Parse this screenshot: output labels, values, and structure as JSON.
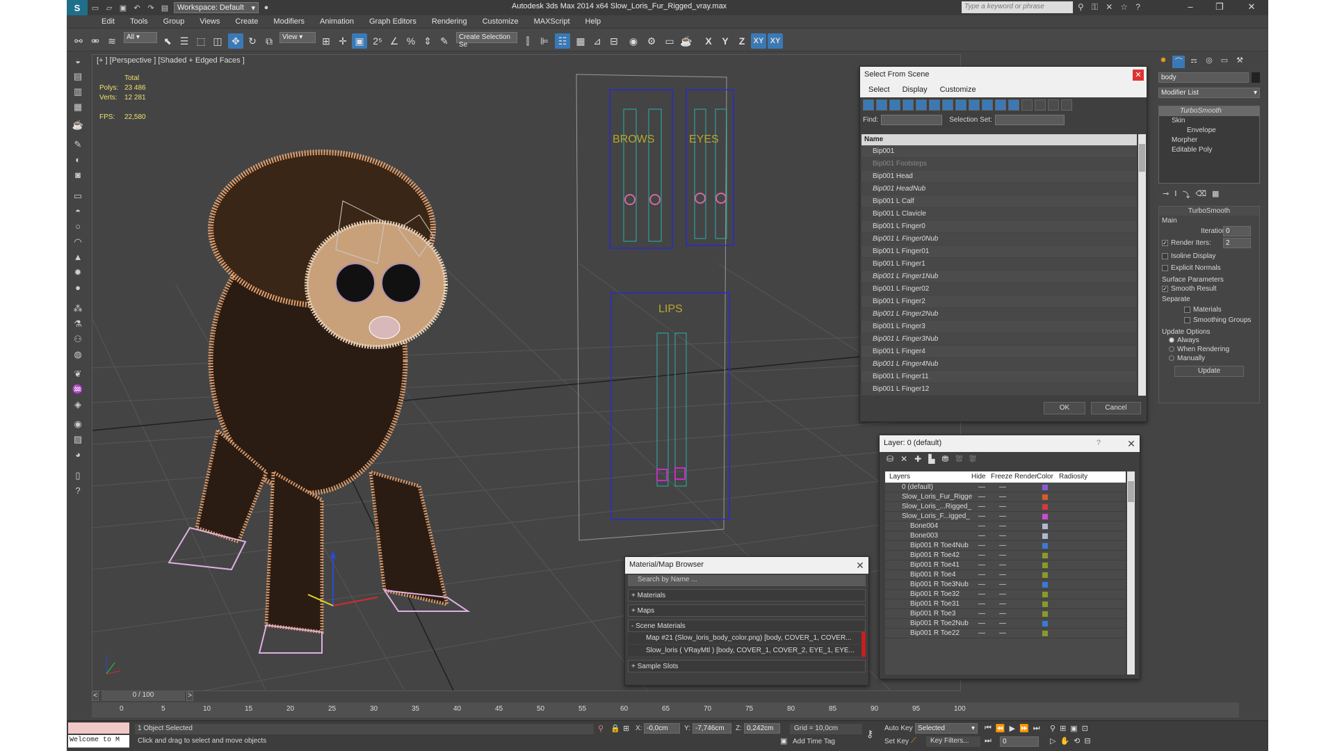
{
  "titlebar": {
    "app_title": "Autodesk 3ds Max  2014 x64     Slow_Loris_Fur_Rigged_vray.max",
    "workspace": "Workspace: Default",
    "search_placeholder": "Type a keyword or phrase"
  },
  "menu": [
    "Edit",
    "Tools",
    "Group",
    "Views",
    "Create",
    "Modifiers",
    "Animation",
    "Graph Editors",
    "Rendering",
    "Customize",
    "MAXScript",
    "Help"
  ],
  "toolbar": {
    "filter_select": "All",
    "coord_select": "View",
    "selection_set": "Create Selection Se",
    "axis_x": "X",
    "axis_y": "Y",
    "axis_z": "Z",
    "axis_xy": "XY",
    "axis_xy2": "XY"
  },
  "viewport": {
    "label": "[+ ] [Perspective ] [Shaded + Edged Faces ]",
    "stats_header": "Total",
    "polys_label": "Polys:",
    "polys": "23 486",
    "verts_label": "Verts:",
    "verts": "12 281",
    "fps_label": "FPS:",
    "fps": "22,580",
    "brows_label": "BROWS",
    "eyes_label": "EYES",
    "lips_label": "LIPS"
  },
  "select_from_scene": {
    "title": "Select From Scene",
    "menu": [
      "Select",
      "Display",
      "Customize"
    ],
    "find_label": "Find:",
    "selection_set_label": "Selection Set:",
    "column_name": "Name",
    "items": [
      {
        "name": "Bip001",
        "style": "normal"
      },
      {
        "name": "Bip001 Footsteps",
        "style": "dim"
      },
      {
        "name": "Bip001 Head",
        "style": "normal"
      },
      {
        "name": "Bip001 HeadNub",
        "style": "italic"
      },
      {
        "name": "Bip001 L Calf",
        "style": "normal"
      },
      {
        "name": "Bip001 L Clavicle",
        "style": "normal"
      },
      {
        "name": "Bip001 L Finger0",
        "style": "normal"
      },
      {
        "name": "Bip001 L Finger0Nub",
        "style": "italic"
      },
      {
        "name": "Bip001 L Finger01",
        "style": "normal"
      },
      {
        "name": "Bip001 L Finger1",
        "style": "normal"
      },
      {
        "name": "Bip001 L Finger1Nub",
        "style": "italic"
      },
      {
        "name": "Bip001 L Finger02",
        "style": "normal"
      },
      {
        "name": "Bip001 L Finger2",
        "style": "normal"
      },
      {
        "name": "Bip001 L Finger2Nub",
        "style": "italic"
      },
      {
        "name": "Bip001 L Finger3",
        "style": "normal"
      },
      {
        "name": "Bip001 L Finger3Nub",
        "style": "italic"
      },
      {
        "name": "Bip001 L Finger4",
        "style": "normal"
      },
      {
        "name": "Bip001 L Finger4Nub",
        "style": "italic"
      },
      {
        "name": "Bip001 L Finger11",
        "style": "normal"
      },
      {
        "name": "Bip001 L Finger12",
        "style": "normal"
      }
    ],
    "ok": "OK",
    "cancel": "Cancel"
  },
  "layer_dialog": {
    "title": "Layer: 0 (default)",
    "help": "?",
    "columns": [
      "Layers",
      "Hide",
      "Freeze",
      "Render",
      "Color",
      "Radiosity"
    ],
    "rows": [
      {
        "name": "0 (default)",
        "color": "#8a5ad8",
        "indent": 0
      },
      {
        "name": "Slow_Loris_Fur_Rigge",
        "color": "#d85a2a",
        "indent": 0
      },
      {
        "name": "Slow_Loris_...Rigged_",
        "color": "#d83a3a",
        "indent": 0
      },
      {
        "name": "Slow_Loris_F...igged_",
        "color": "#c84ad8",
        "indent": 0
      },
      {
        "name": "Bone004",
        "color": "#b0b8d0",
        "indent": 1
      },
      {
        "name": "Bone003",
        "color": "#b0b8d0",
        "indent": 1
      },
      {
        "name": "Bip001 R Toe4Nub",
        "color": "#3a7ad8",
        "indent": 1
      },
      {
        "name": "Bip001 R Toe42",
        "color": "#8a9a2a",
        "indent": 1
      },
      {
        "name": "Bip001 R Toe41",
        "color": "#8a9a2a",
        "indent": 1
      },
      {
        "name": "Bip001 R Toe4",
        "color": "#8a9a2a",
        "indent": 1
      },
      {
        "name": "Bip001 R Toe3Nub",
        "color": "#3a7ad8",
        "indent": 1
      },
      {
        "name": "Bip001 R Toe32",
        "color": "#8a9a2a",
        "indent": 1
      },
      {
        "name": "Bip001 R Toe31",
        "color": "#8a9a2a",
        "indent": 1
      },
      {
        "name": "Bip001 R Toe3",
        "color": "#8a9a2a",
        "indent": 1
      },
      {
        "name": "Bip001 R Toe2Nub",
        "color": "#3a7ad8",
        "indent": 1
      },
      {
        "name": "Bip001 R Toe22",
        "color": "#8a9a2a",
        "indent": 1
      }
    ]
  },
  "material_browser": {
    "title": "Material/Map Browser",
    "search_placeholder": "Search by Name ...",
    "sections": {
      "materials": "+ Materials",
      "maps": "+ Maps",
      "scene_materials": "- Scene Materials",
      "sample_slots": "+ Sample Slots"
    },
    "scene_items": [
      "Map #21 (Slow_loris_body_color.png) [body, COVER_1, COVER...",
      "Slow_loris  ( VRayMtl ) [body, COVER_1, COVER_2, EYE_1, EYE..."
    ]
  },
  "command_panel": {
    "object_name": "body",
    "modifier_list": "Modifier List",
    "stack": [
      "TurboSmooth",
      "Skin",
      "Envelope",
      "Morpher",
      "Editable Poly"
    ],
    "rollout_title": "TurboSmooth",
    "main_label": "Main",
    "iterations_label": "Iterations:",
    "iterations": "0",
    "render_iters_label": "Render Iters:",
    "render_iters": "2",
    "isoline": "Isoline Display",
    "explicit": "Explicit Normals",
    "surface_params": "Surface Parameters",
    "smooth_result": "Smooth Result",
    "separate": "Separate",
    "materials": "Materials",
    "smoothing_groups": "Smoothing Groups",
    "update_options": "Update Options",
    "always": "Always",
    "when_rendering": "When Rendering",
    "manually": "Manually",
    "update": "Update"
  },
  "timeline": {
    "frame": "0 / 100",
    "ticks": [
      "0",
      "5",
      "10",
      "15",
      "20",
      "25",
      "30",
      "35",
      "40",
      "45",
      "50",
      "55",
      "60",
      "65",
      "70",
      "75",
      "80",
      "85",
      "90",
      "95",
      "100"
    ]
  },
  "status": {
    "maxscript": "Welcome to M",
    "selected": "1 Object Selected",
    "prompt": "Click and drag to select and move objects",
    "x_label": "X:",
    "x": "-0,0cm",
    "y_label": "Y:",
    "y": "-7,746cm",
    "z_label": "Z:",
    "z": "0,242cm",
    "grid": "Grid = 10,0cm",
    "add_time_tag": "Add Time Tag",
    "auto_key": "Auto Key",
    "set_key": "Set Key",
    "selected_dd": "Selected",
    "key_filters": "Key Filters...",
    "frame_field": "0"
  }
}
